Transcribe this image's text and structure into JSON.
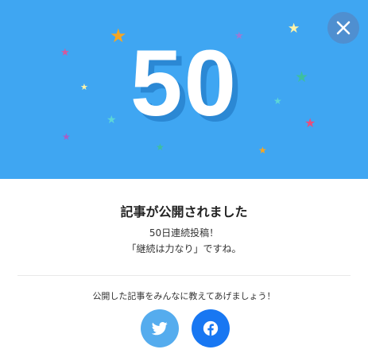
{
  "hero": {
    "number": "50",
    "background_color": "#3fa6f2",
    "decorations": [
      {
        "icon": "star-icon",
        "color": "#f5a623"
      },
      {
        "icon": "star-icon",
        "color": "#d6589c"
      },
      {
        "icon": "star-icon",
        "color": "#fff4a8"
      },
      {
        "icon": "star-icon",
        "color": "#5cd6d6"
      },
      {
        "icon": "star-icon",
        "color": "#a75ec6"
      },
      {
        "icon": "star-icon",
        "color": "#9b7ad6"
      },
      {
        "icon": "star-icon",
        "color": "#fff4a8"
      },
      {
        "icon": "star-icon",
        "color": "#3dbfa0"
      },
      {
        "icon": "star-icon",
        "color": "#5cd6d6"
      },
      {
        "icon": "star-icon",
        "color": "#e64f7d"
      },
      {
        "icon": "star-icon",
        "color": "#f5a623"
      },
      {
        "icon": "star-icon",
        "color": "#3dbfa0"
      }
    ]
  },
  "close_button": {
    "icon": "close-icon"
  },
  "title": "記事が公開されました",
  "message": {
    "line1": "50日連続投稿！",
    "line2": "「継続は力なり」ですね。"
  },
  "share": {
    "prompt": "公開した記事をみんなに教えてあげましょう！",
    "buttons": [
      {
        "name": "twitter",
        "icon": "twitter-icon",
        "color": "#55acee"
      },
      {
        "name": "facebook",
        "icon": "facebook-icon",
        "color": "#1877f2"
      }
    ]
  }
}
